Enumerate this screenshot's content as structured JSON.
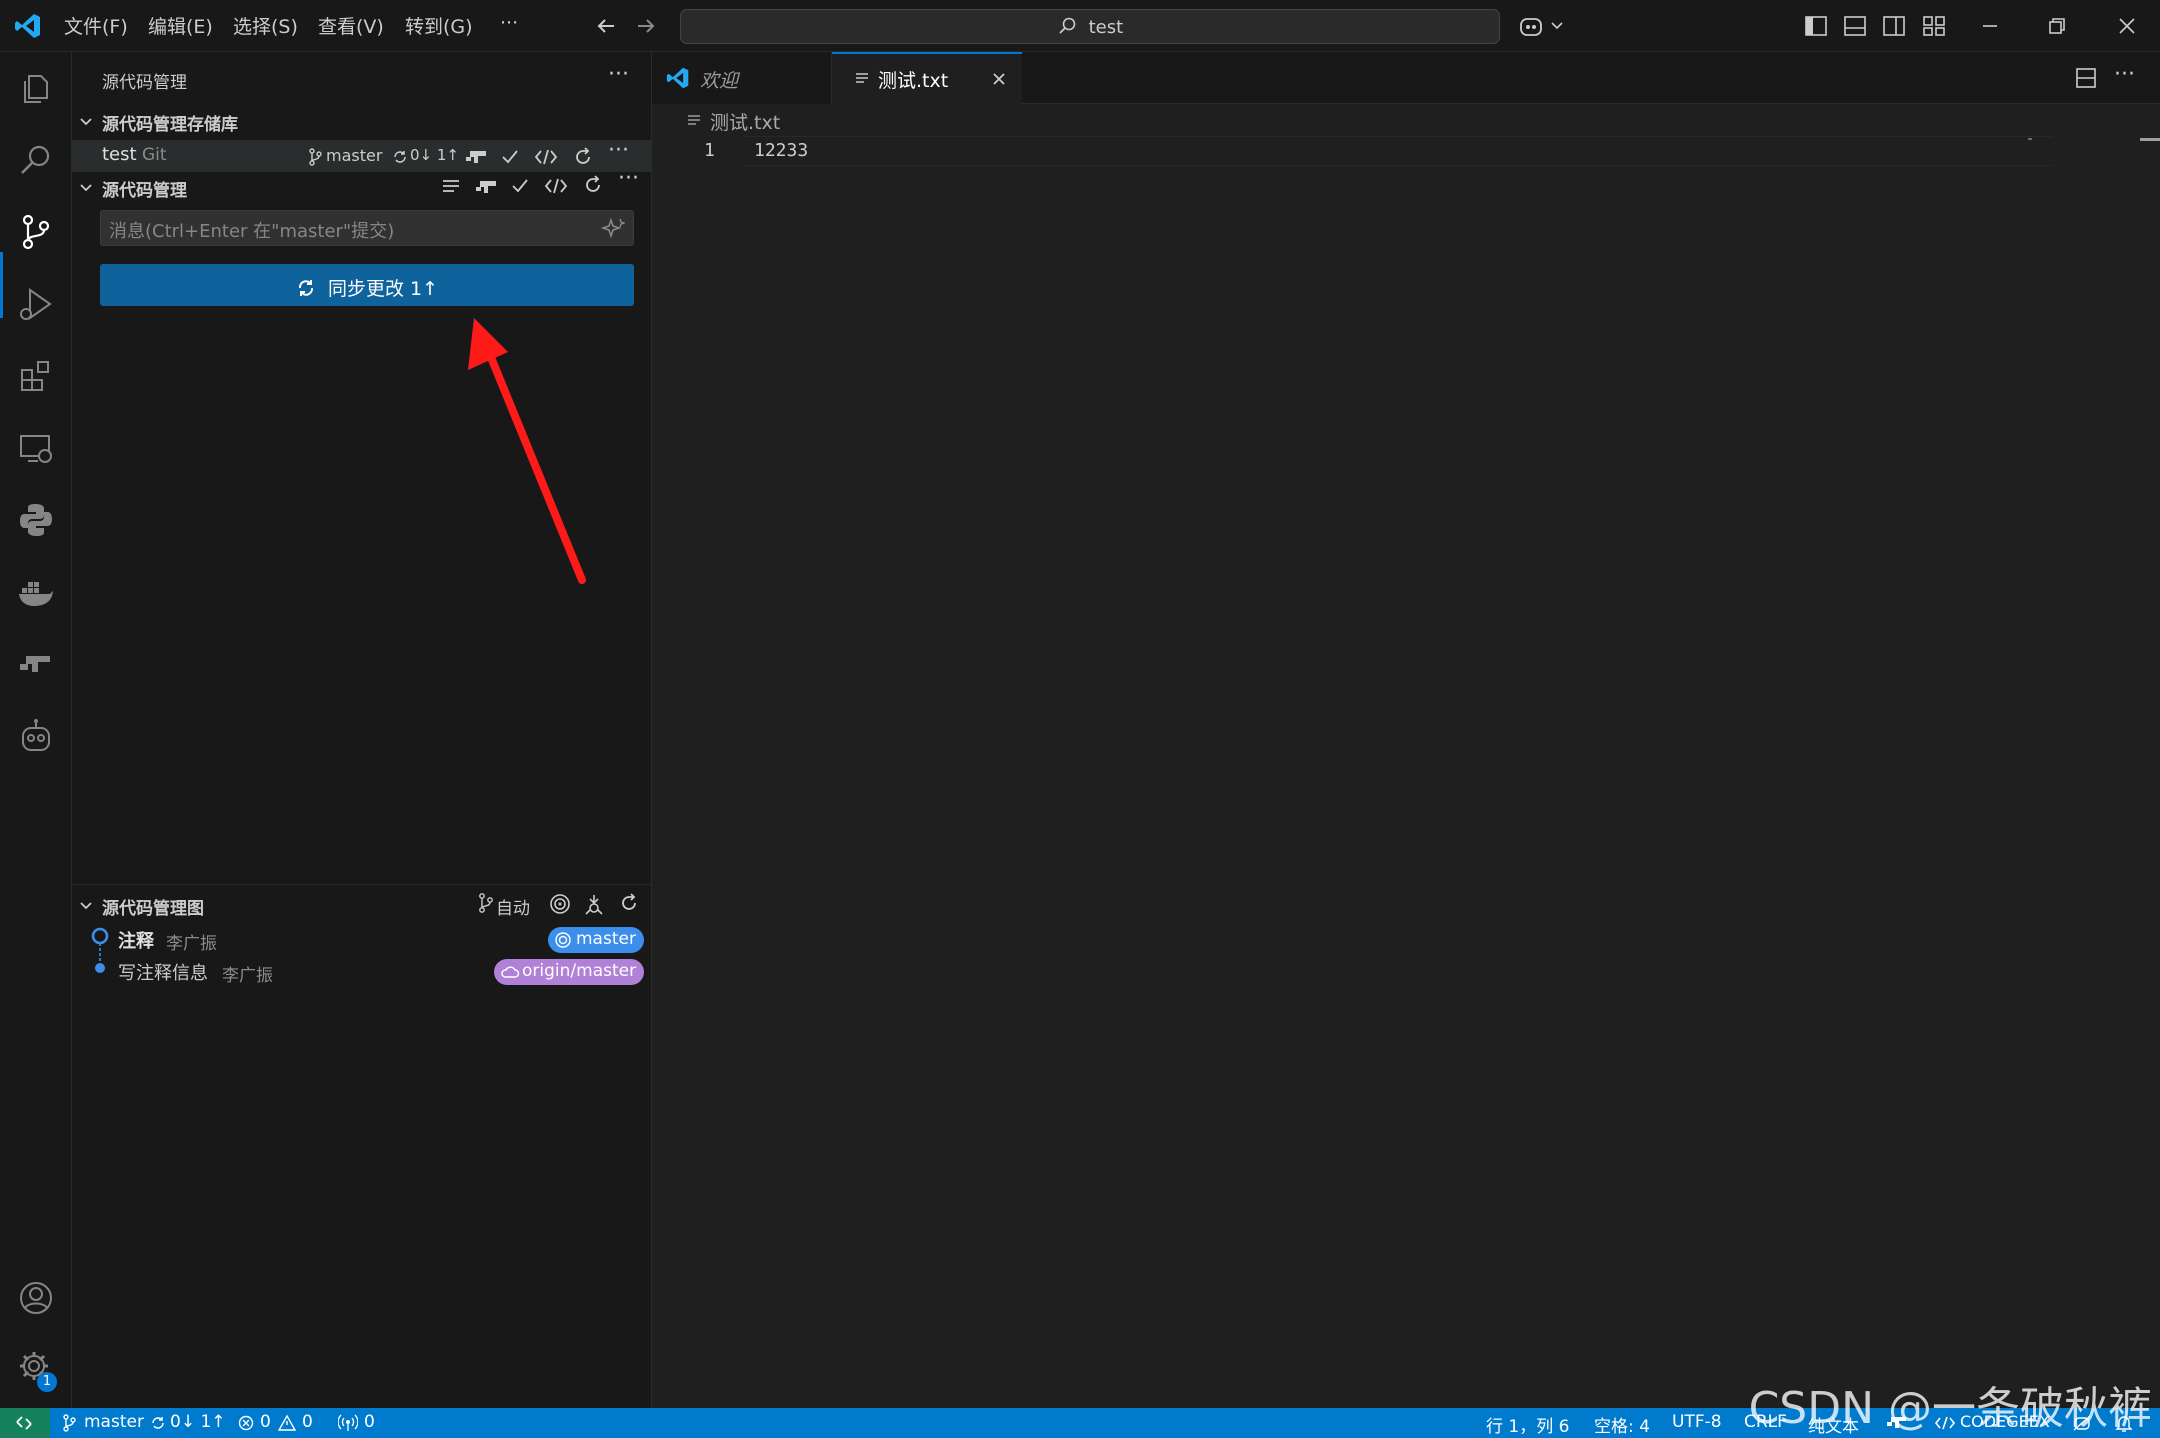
{
  "titlebar": {
    "menu": [
      "文件(F)",
      "编辑(E)",
      "选择(S)",
      "查看(V)",
      "转到(G)",
      "···"
    ],
    "search": "test"
  },
  "sidebar": {
    "title": "源代码管理",
    "repos_header": "源代码管理存储库",
    "repo": {
      "name": "test",
      "type": "Git",
      "branch": "master",
      "sync": "0↓ 1↑"
    },
    "scm_header": "源代码管理",
    "commit_placeholder": "消息(Ctrl+Enter 在\"master\"提交)",
    "sync_button": "同步更改 1↑",
    "graph_header": "源代码管理图",
    "graph_mode": "自动",
    "commits": [
      {
        "message": "注释",
        "author": "李广振",
        "badge": "master"
      },
      {
        "message": "写注释信息",
        "author": "李广振",
        "badge": "origin/master"
      }
    ]
  },
  "tabs": [
    {
      "label": "欢迎"
    },
    {
      "label": "测试.txt"
    }
  ],
  "editor": {
    "breadcrumb": "测试.txt",
    "lines": [
      {
        "number": "1",
        "text": "12233"
      }
    ]
  },
  "statusbar": {
    "branch": "master",
    "sync": "0↓ 1↑",
    "errors": "0",
    "warnings": "0",
    "ports": "0",
    "position": "行 1，列 6",
    "spaces": "空格: 4",
    "encoding": "UTF-8",
    "eol": "CRLF",
    "language": "纯文本",
    "codegeex": "CODEGEEX"
  },
  "settings_badge": "1",
  "watermark": "CSDN @一条破秋裤",
  "colors": {
    "accent": "#0078d4",
    "button": "#0e639c",
    "statusbar": "#007acc",
    "arrow": "#ff1a1a",
    "badge_master": "#3b8eea",
    "badge_origin": "#b180d7"
  }
}
